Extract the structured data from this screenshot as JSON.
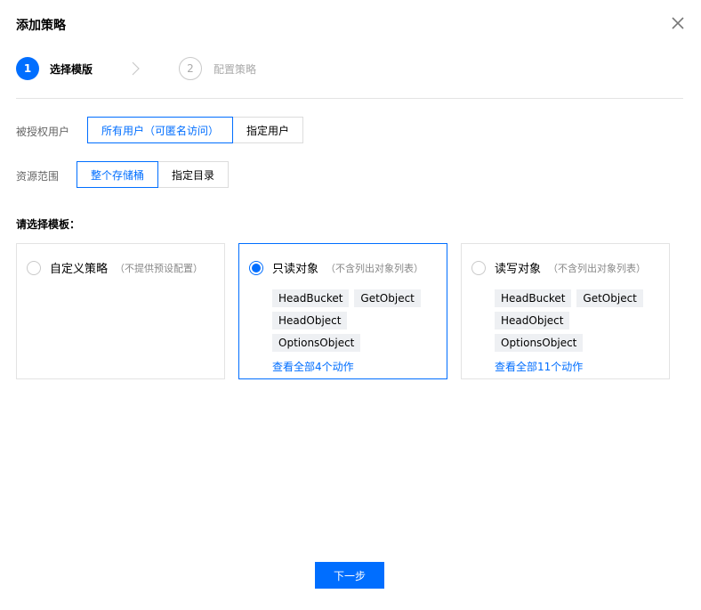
{
  "dialog": {
    "title": "添加策略"
  },
  "steps": [
    {
      "number": "1",
      "label": "选择模版",
      "active": true
    },
    {
      "number": "2",
      "label": "配置策略",
      "active": false
    }
  ],
  "grantee": {
    "label": "被授权用户",
    "options": [
      "所有用户（可匿名访问）",
      "指定用户"
    ],
    "selected": "所有用户（可匿名访问）"
  },
  "scope": {
    "label": "资源范围",
    "options": [
      "整个存储桶",
      "指定目录"
    ],
    "selected": "整个存储桶"
  },
  "templates": {
    "title": "请选择模板：",
    "cards": [
      {
        "name": "自定义策略",
        "note": "（不提供预设配置）",
        "checked": false,
        "tags": [],
        "view_all": ""
      },
      {
        "name": "只读对象",
        "note": "（不含列出对象列表）",
        "checked": true,
        "tags": [
          "HeadBucket",
          "GetObject",
          "HeadObject",
          "OptionsObject"
        ],
        "view_all": "查看全部4个动作"
      },
      {
        "name": "读写对象",
        "note": "（不含列出对象列表）",
        "checked": false,
        "tags": [
          "HeadBucket",
          "GetObject",
          "HeadObject",
          "OptionsObject"
        ],
        "view_all": "查看全部11个动作"
      }
    ]
  },
  "footer": {
    "next_label": "下一步"
  },
  "colors": {
    "accent": "#006eff",
    "tag_bg": "#eef0f3",
    "border": "#e3e3e3"
  }
}
